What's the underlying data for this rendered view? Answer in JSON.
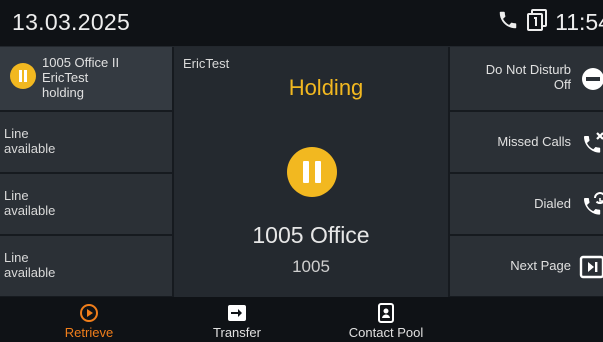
{
  "status_bar": {
    "date": "13.03.2025",
    "time": "11:54",
    "icons": [
      "phone-icon",
      "line-number-1-icon"
    ]
  },
  "lines": [
    {
      "title": "1005 Office II",
      "name": "EricTest",
      "state": "holding",
      "icon": "hold-icon",
      "color": "#f2b820"
    },
    {
      "label": "Line\navailable"
    },
    {
      "label": "Line\navailable"
    },
    {
      "label": "Line\navailable"
    }
  ],
  "call": {
    "contact_tag": "EricTest",
    "state": "Holding",
    "remote_name": "1005 Office",
    "remote_number": "1005",
    "state_color": "#f2b820"
  },
  "softkeys": [
    {
      "label": "Do Not Disturb\nOff",
      "icon": "do-not-disturb-icon"
    },
    {
      "label": "Missed Calls",
      "icon": "missed-calls-icon"
    },
    {
      "label": "Dialed",
      "icon": "dialed-calls-icon"
    },
    {
      "label": "Next Page",
      "icon": "next-page-icon"
    }
  ],
  "toolbar": [
    {
      "label": "Retrieve",
      "icon": "retrieve-icon",
      "active": true,
      "color": "#f07e1b"
    },
    {
      "label": "Transfer",
      "icon": "transfer-icon"
    },
    {
      "label": "Contact Pool",
      "icon": "contact-pool-icon"
    }
  ]
}
